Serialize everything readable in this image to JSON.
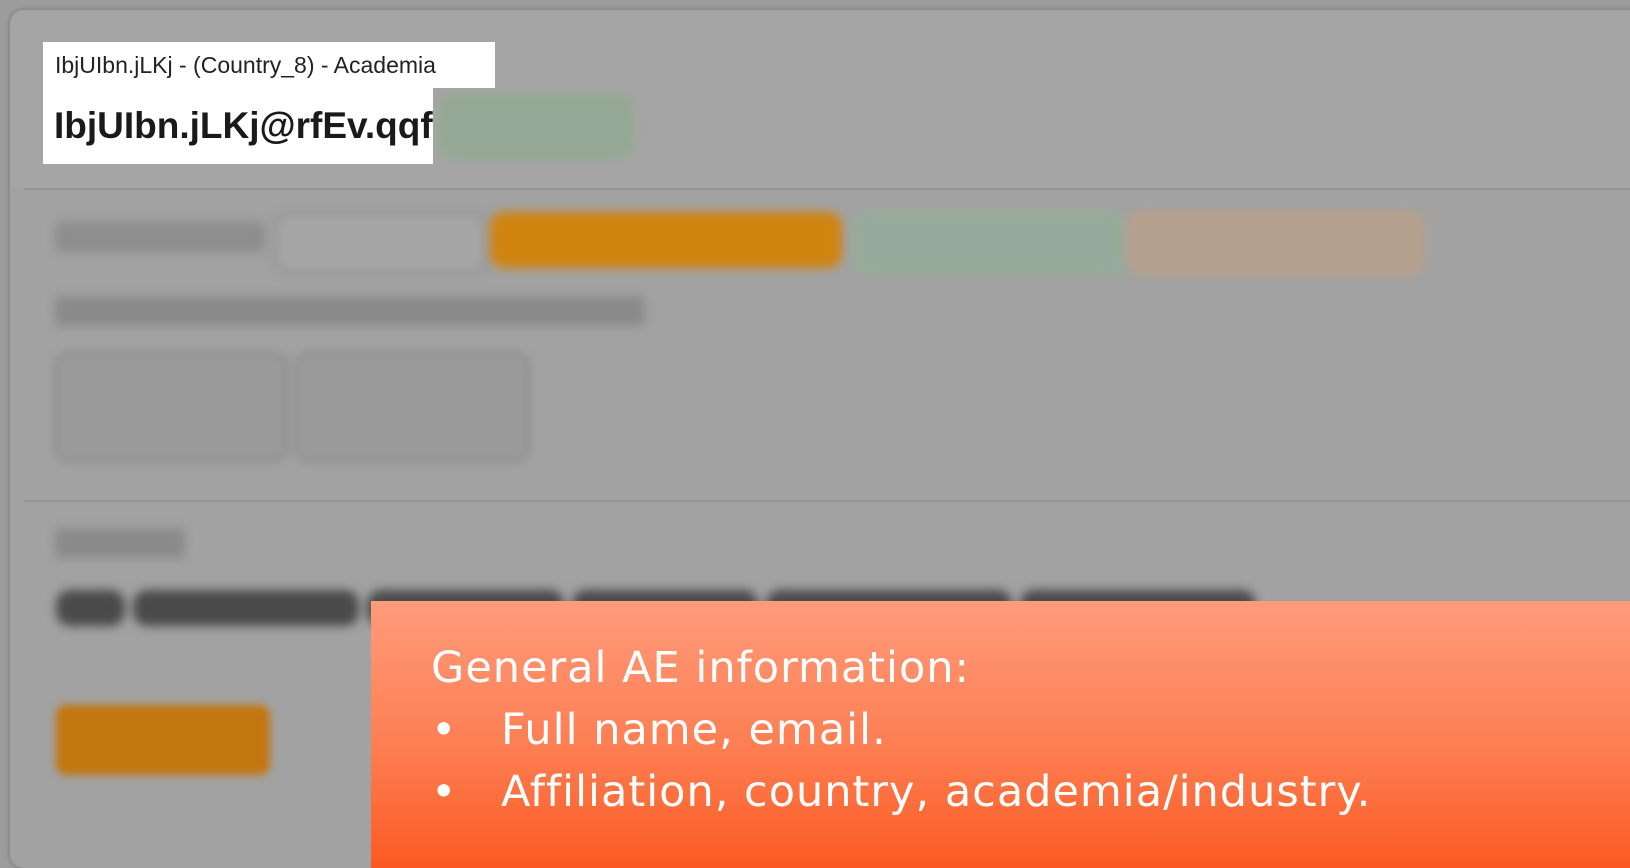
{
  "header": {
    "subtitle": "IbjUIbn.jLKj - (Country_8) - Academia",
    "email": "IbjUIbn.jLKj@rfEv.qqf"
  },
  "callout": {
    "title": "General AE information:",
    "items": [
      "Full name, email.",
      "Affiliation, country, academia/industry."
    ]
  },
  "colors": {
    "callout_top": "#ff9b7b",
    "callout_bottom": "#fb5a22",
    "background": "#9c9c9c"
  }
}
